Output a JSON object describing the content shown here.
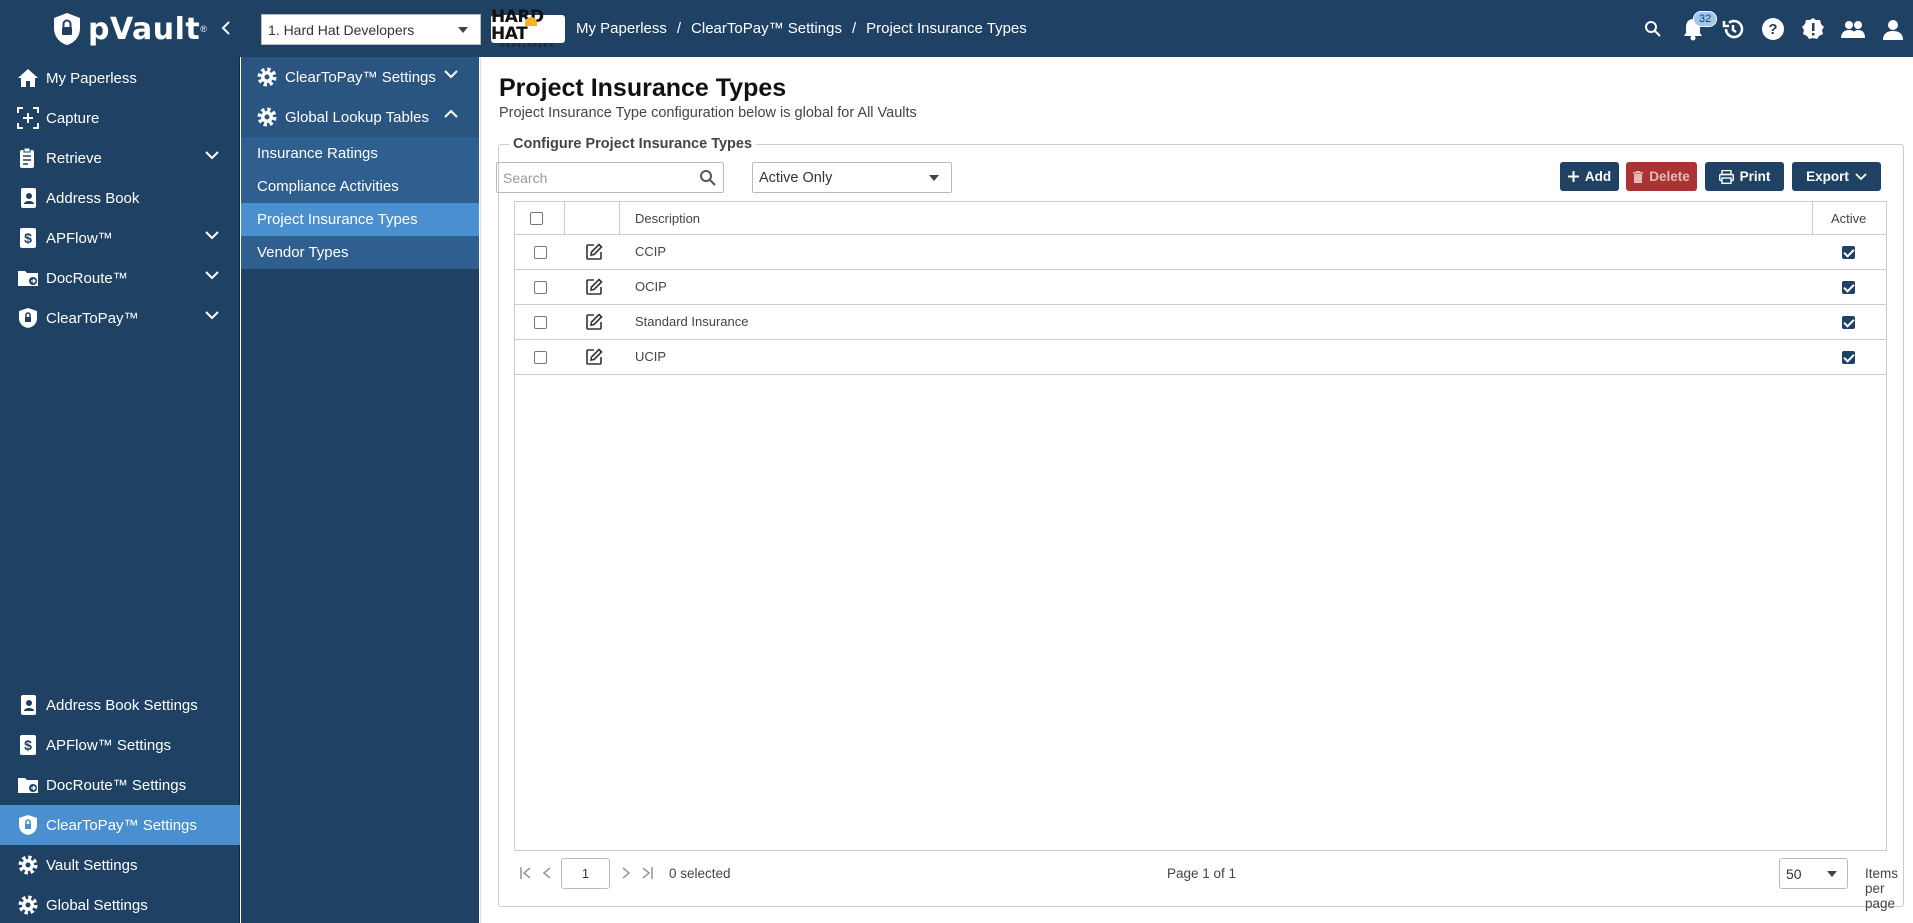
{
  "app": {
    "name": "pVault",
    "trademark": "®"
  },
  "vault_select": {
    "value": "1. Hard Hat Developers"
  },
  "company_logo": {
    "text": "HARD HAT",
    "subtext": "DEVELOPERS"
  },
  "breadcrumb": [
    "My Paperless",
    "ClearToPay™ Settings",
    "Project Insurance Types"
  ],
  "breadcrumb_sep": "/",
  "notifications": {
    "count": "32"
  },
  "sidebar": {
    "top_items": [
      {
        "label": "My Paperless",
        "icon": "home-icon"
      },
      {
        "label": "Capture",
        "icon": "capture-icon"
      },
      {
        "label": "Retrieve",
        "icon": "retrieve-icon",
        "expandable": true
      },
      {
        "label": "Address Book",
        "icon": "address-book-icon"
      },
      {
        "label": "APFlow™",
        "icon": "apflow-icon",
        "expandable": true
      },
      {
        "label": "DocRoute™",
        "icon": "docroute-icon",
        "expandable": true
      },
      {
        "label": "ClearToPay™",
        "icon": "cleartopay-icon",
        "expandable": true
      }
    ],
    "bottom_items": [
      {
        "label": "Address Book Settings",
        "icon": "address-book-icon"
      },
      {
        "label": "APFlow™ Settings",
        "icon": "apflow-icon"
      },
      {
        "label": "DocRoute™ Settings",
        "icon": "docroute-icon"
      },
      {
        "label": "ClearToPay™ Settings",
        "icon": "cleartopay-icon",
        "active": true
      },
      {
        "label": "Vault Settings",
        "icon": "gear-icon"
      },
      {
        "label": "Global Settings",
        "icon": "gear-icon"
      }
    ]
  },
  "subnav": {
    "sections": [
      {
        "label": "ClearToPay™ Settings",
        "icon": "gear-icon",
        "state": "collapsed"
      },
      {
        "label": "Global Lookup Tables",
        "icon": "gear-icon",
        "state": "expanded"
      }
    ],
    "links": [
      {
        "label": "Insurance Ratings"
      },
      {
        "label": "Compliance Activities"
      },
      {
        "label": "Project Insurance Types",
        "active": true
      },
      {
        "label": "Vendor Types"
      }
    ]
  },
  "main": {
    "title": "Project Insurance Types",
    "subtitle": "Project Insurance Type configuration below is global for All Vaults",
    "fieldset_legend": "Configure Project Insurance Types",
    "search_placeholder": "Search",
    "filter_value": "Active Only",
    "buttons": {
      "add": "Add",
      "delete": "Delete",
      "print": "Print",
      "export": "Export"
    },
    "columns": {
      "description": "Description",
      "active": "Active"
    },
    "rows": [
      {
        "description": "CCIP",
        "active": true
      },
      {
        "description": "OCIP",
        "active": true
      },
      {
        "description": "Standard Insurance",
        "active": true
      },
      {
        "description": "UCIP",
        "active": true
      }
    ],
    "pager": {
      "page": "1",
      "selected": "0 selected",
      "page_info": "Page 1 of 1",
      "per_page": "50",
      "per_page_label": "Items per page"
    }
  },
  "colors": {
    "nav_bg": "#1f4164",
    "active": "#4a8fd0",
    "delete": "#aa3333"
  }
}
